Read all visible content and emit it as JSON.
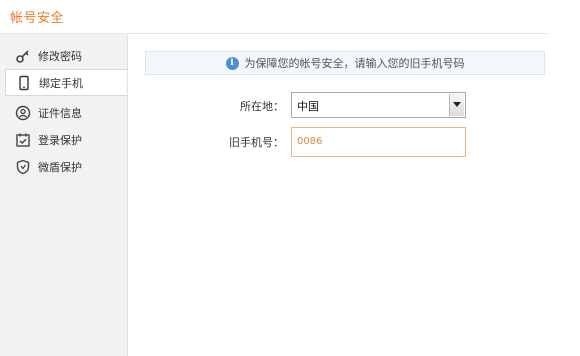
{
  "header": {
    "title": "帐号安全"
  },
  "sidebar": {
    "items": [
      {
        "label": "修改密码",
        "icon": "key-icon"
      },
      {
        "label": "绑定手机",
        "icon": "phone-icon"
      },
      {
        "label": "证件信息",
        "icon": "id-card-icon"
      },
      {
        "label": "登录保护",
        "icon": "calendar-check-icon"
      },
      {
        "label": "微盾保护",
        "icon": "shield-icon"
      }
    ],
    "active_index": 1
  },
  "notice": {
    "text": "为保障您的帐号安全，请输入您的旧手机号码",
    "icon": "info-icon"
  },
  "form": {
    "location_label": "所在地：",
    "location_value": "中国",
    "old_phone_label": "旧手机号：",
    "old_phone_value": "0086"
  },
  "colors": {
    "accent": "#f07a2a",
    "info": "#4a8fd6",
    "input_border": "#e8b78f",
    "input_text": "#d4884a"
  }
}
